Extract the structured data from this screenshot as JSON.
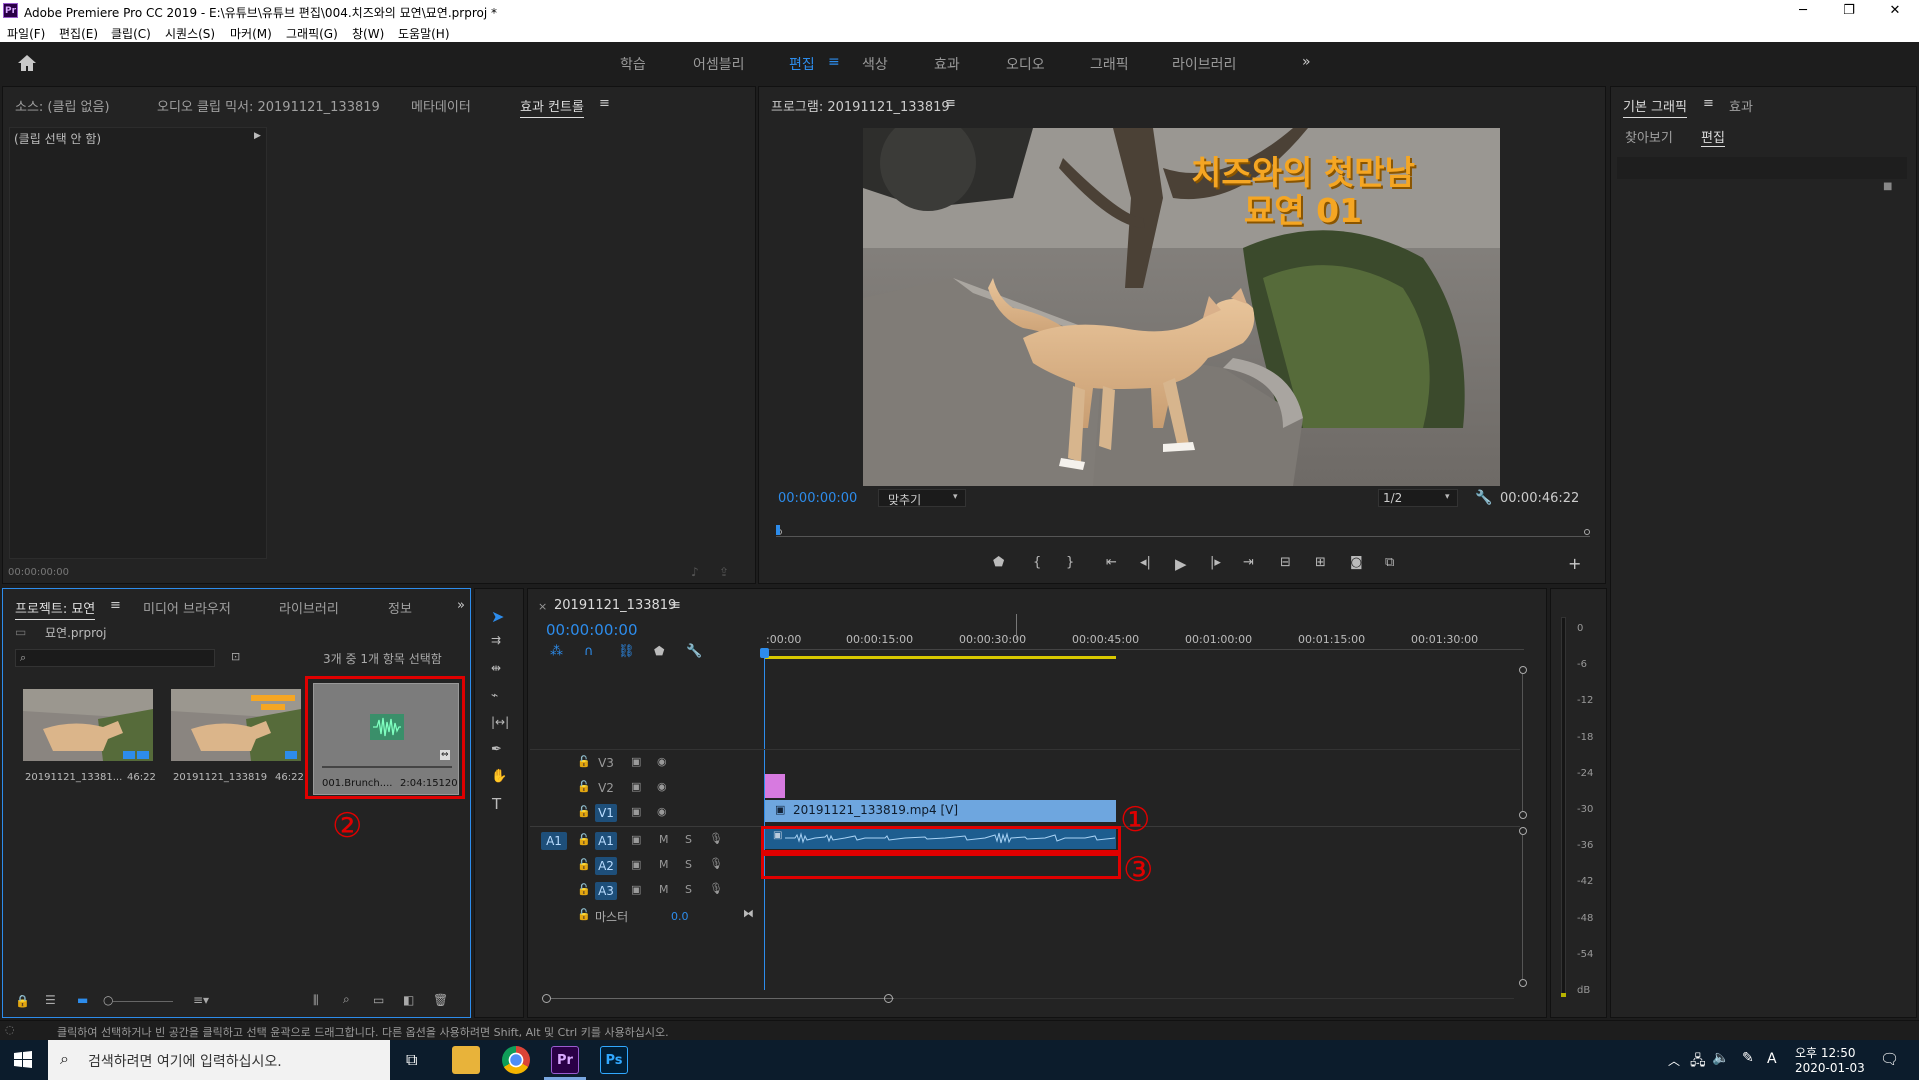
{
  "window": {
    "title": "Adobe Premiere Pro CC 2019 - E:\\유튜브\\유튜브 편집\\004.치즈와의 묘연\\묘연.prproj *",
    "app_badge": "Pr",
    "minimize": "─",
    "maximize": "❐",
    "close": "✕"
  },
  "menu": [
    "파일(F)",
    "편집(E)",
    "클립(C)",
    "시퀀스(S)",
    "마커(M)",
    "그래픽(G)",
    "창(W)",
    "도움말(H)"
  ],
  "workspaces": {
    "items": [
      "학습",
      "어셈블리",
      "편집",
      "색상",
      "효과",
      "오디오",
      "그래픽",
      "라이브러리"
    ],
    "active": "편집",
    "more": "»"
  },
  "source_panel": {
    "tabs": [
      "소스: (클립 없음)",
      "오디오 클립 믹서: 20191121_133819",
      "메타데이터",
      "효과 컨트롤"
    ],
    "active_tab": "효과 컨트롤",
    "no_clip": "(클립 선택 안 함)",
    "timecode": "00:00:00:00"
  },
  "program_monitor": {
    "title": "프로그램: 20191121_133819",
    "overlay_line1": "치즈와의 첫만남",
    "overlay_line2": "묘연 01",
    "timecode": "00:00:00:00",
    "fit": "맞추기",
    "resolution": "1/2",
    "duration": "00:00:46:22"
  },
  "essential_graphics": {
    "tabs": [
      "기본 그래픽",
      "효과"
    ],
    "subtabs": [
      "찾아보기",
      "편집"
    ],
    "active_subtab": "편집"
  },
  "project_panel": {
    "tabs": [
      "프로젝트: 묘연",
      "미디어 브라우저",
      "라이브러리",
      "정보"
    ],
    "file": "묘연.prproj",
    "search_placeholder": "",
    "selection": "3개 중 1개 항목 선택함",
    "items": [
      {
        "name": "20191121_13381...",
        "duration": "46:22"
      },
      {
        "name": "20191121_133819",
        "duration": "46:22"
      },
      {
        "name": "001.Brunch....",
        "duration": "2:04:15120"
      }
    ]
  },
  "timeline": {
    "sequence": "20191121_133819",
    "timecode": "00:00:00:00",
    "ruler": [
      ":00:00",
      "00:00:15:00",
      "00:00:30:00",
      "00:00:45:00",
      "00:01:00:00",
      "00:01:15:00",
      "00:01:30:00"
    ],
    "video_tracks": [
      "V3",
      "V2",
      "V1"
    ],
    "audio_tracks": [
      "A1",
      "A2",
      "A3"
    ],
    "source_patch": "A1",
    "master_label": "마스터",
    "master_value": "0.0",
    "clip_v1": "20191121_133819.mp4 [V]",
    "mute": "M",
    "solo": "S"
  },
  "meter_scale": [
    "0",
    "-6",
    "-12",
    "-18",
    "-24",
    "-30",
    "-36",
    "-42",
    "-48",
    "-54",
    "dB"
  ],
  "annotations": [
    "①",
    "②",
    "③"
  ],
  "status_bar": "클릭하여 선택하거나 빈 공간을 클릭하고 선택 윤곽으로 드래그합니다. 다른 옵션을 사용하려면 Shift, Alt 및 Ctrl 키를 사용하십시오.",
  "taskbar": {
    "search_placeholder": "검색하려면 여기에 입력하십시오.",
    "time_ampm": "오후 12:50",
    "date": "2020-01-03",
    "ime": "A"
  }
}
